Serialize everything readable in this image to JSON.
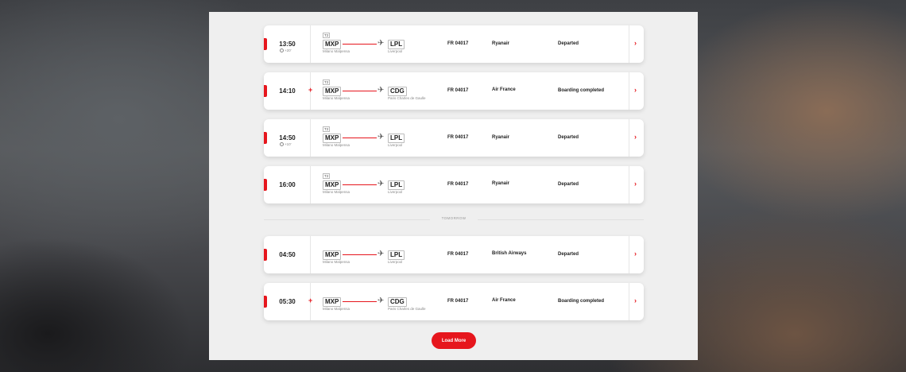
{
  "flights": [
    {
      "time": "13:50",
      "delay": "+20'",
      "terminal": "T2",
      "from_code": "MXP",
      "from_city": "Milano Malpensa",
      "to_code": "LPL",
      "to_city": "Liverpool",
      "flight_no": "FR 04017",
      "airline": "Ryanair",
      "status": "Departed"
    },
    {
      "time": "14:10",
      "plus": "+",
      "terminal": "T2",
      "from_code": "MXP",
      "from_city": "Milano Malpensa",
      "to_code": "CDG",
      "to_city": "Paris Charles de Gaulle",
      "flight_no": "FR 04017",
      "airline": "Air France",
      "status": "Boarding completed"
    },
    {
      "time": "14:50",
      "delay": "+10'",
      "terminal": "T2",
      "from_code": "MXP",
      "from_city": "Milano Malpensa",
      "to_code": "LPL",
      "to_city": "Liverpool",
      "flight_no": "FR 04017",
      "airline": "Ryanair",
      "status": "Departed"
    },
    {
      "time": "16:00",
      "terminal": "T2",
      "from_code": "MXP",
      "from_city": "Milano Malpensa",
      "to_code": "LPL",
      "to_city": "Liverpool",
      "flight_no": "FR 04017",
      "airline": "Ryanair",
      "status": "Departed"
    },
    {
      "time": "04:50",
      "from_code": "MXP",
      "from_city": "Milano Malpensa",
      "to_code": "LPL",
      "to_city": "Liverpool",
      "flight_no": "FR 04017",
      "airline": "British Airways",
      "status": "Departed"
    },
    {
      "time": "05:30",
      "plus": "+",
      "from_code": "MXP",
      "from_city": "Milano Malpensa",
      "to_code": "CDG",
      "to_city": "Paris Charles de Gaulle",
      "flight_no": "FR 04017",
      "airline": "Air France",
      "status": "Boarding completed"
    }
  ],
  "separator_label": "TOMORROW",
  "load_more_label": "Load More",
  "icons": {
    "plane": "plane-icon",
    "chevron": "chevron-right-icon",
    "clock": "clock-icon"
  },
  "colors": {
    "accent": "#e6161d",
    "panel_bg": "#efefef",
    "card_bg": "#ffffff",
    "text": "#1d1d1d"
  }
}
